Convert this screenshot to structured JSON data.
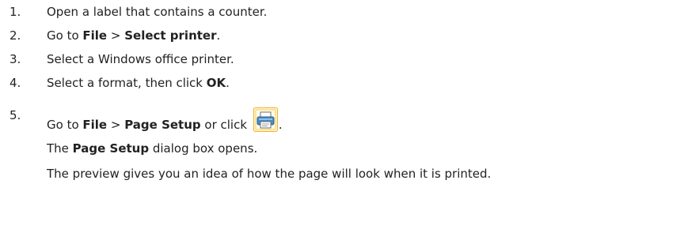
{
  "steps": [
    {
      "number": "1.",
      "text": "Open a label that contains a counter."
    },
    {
      "number": "2.",
      "prefix": "Go to ",
      "menu": "File",
      "separator": " > ",
      "item": "Select printer",
      "suffix": "."
    },
    {
      "number": "3.",
      "text": "Select a Windows office printer."
    },
    {
      "number": "4.",
      "prefix": "Select a format, then click ",
      "button": "OK",
      "suffix": "."
    },
    {
      "number": "5.",
      "prefix": "Go to ",
      "menu": "File",
      "separator": " > ",
      "item": "Page Setup",
      "middle": " or click ",
      "icon": "page-setup-printer-icon",
      "suffix": ".",
      "result_bold": "Page Setup",
      "result_text": " dialog box opens.",
      "result_prefix": "The ",
      "note": "The preview gives you an idea of how the page will look when it is printed."
    }
  ],
  "colors": {
    "text": "#222222",
    "icon_frame": "#f2b233",
    "icon_fill": "#fff6cc",
    "icon_printer": "#4a8cc9"
  }
}
